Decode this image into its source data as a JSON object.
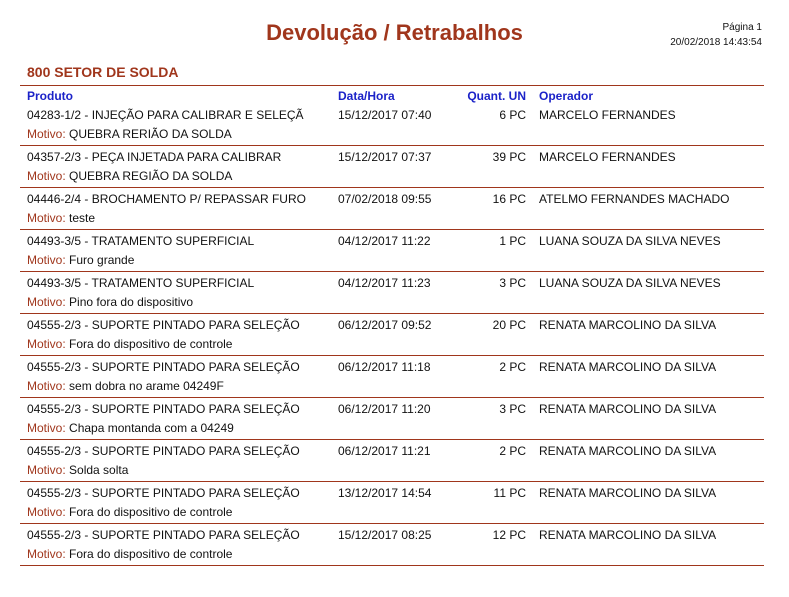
{
  "report": {
    "title": "Devolução / Retrabalhos",
    "page": "Página 1",
    "datetime": "20/02/2018 14:43:54"
  },
  "section": {
    "title": "800 SETOR DE SOLDA"
  },
  "columns": {
    "produto": "Produto",
    "data_hora": "Data/Hora",
    "quant_un": "Quant. UN",
    "operador": "Operador"
  },
  "motivo_label": "Motivo:",
  "rows": [
    {
      "produto": "04283-1/2 - INJEÇÃO PARA CALIBRAR E SELEÇÃ",
      "data_hora": "15/12/2017 07:40",
      "quant": "6 PC",
      "operador": "MARCELO FERNANDES",
      "motivo": "QUEBRA RERIÃO DA SOLDA"
    },
    {
      "produto": "04357-2/3 - PEÇA INJETADA PARA CALIBRAR",
      "data_hora": "15/12/2017 07:37",
      "quant": "39 PC",
      "operador": "MARCELO FERNANDES",
      "motivo": "QUEBRA REGIÃO DA SOLDA"
    },
    {
      "produto": "04446-2/4 - BROCHAMENTO P/ REPASSAR FURO",
      "data_hora": "07/02/2018 09:55",
      "quant": "16 PC",
      "operador": "ATELMO FERNANDES MACHADO",
      "motivo": "teste"
    },
    {
      "produto": "04493-3/5 - TRATAMENTO SUPERFICIAL",
      "data_hora": "04/12/2017 11:22",
      "quant": "1 PC",
      "operador": "LUANA SOUZA DA  SILVA NEVES",
      "motivo": "Furo grande"
    },
    {
      "produto": "04493-3/5 - TRATAMENTO SUPERFICIAL",
      "data_hora": "04/12/2017 11:23",
      "quant": "3 PC",
      "operador": "LUANA SOUZA DA  SILVA NEVES",
      "motivo": "Pino fora do dispositivo"
    },
    {
      "produto": "04555-2/3 - SUPORTE PINTADO PARA SELEÇÃO",
      "data_hora": "06/12/2017 09:52",
      "quant": "20 PC",
      "operador": "RENATA MARCOLINO DA SILVA",
      "motivo": "Fora do dispositivo de controle"
    },
    {
      "produto": "04555-2/3 - SUPORTE PINTADO PARA SELEÇÃO",
      "data_hora": "06/12/2017 11:18",
      "quant": "2 PC",
      "operador": "RENATA MARCOLINO DA SILVA",
      "motivo": "sem dobra no arame 04249F"
    },
    {
      "produto": "04555-2/3 - SUPORTE PINTADO PARA SELEÇÃO",
      "data_hora": "06/12/2017 11:20",
      "quant": "3 PC",
      "operador": "RENATA MARCOLINO DA SILVA",
      "motivo": "Chapa montanda com a 04249"
    },
    {
      "produto": "04555-2/3 - SUPORTE PINTADO PARA SELEÇÃO",
      "data_hora": "06/12/2017 11:21",
      "quant": "2 PC",
      "operador": "RENATA MARCOLINO DA SILVA",
      "motivo": "Solda solta"
    },
    {
      "produto": "04555-2/3 - SUPORTE PINTADO PARA SELEÇÃO",
      "data_hora": "13/12/2017 14:54",
      "quant": "11 PC",
      "operador": "RENATA MARCOLINO DA SILVA",
      "motivo": "Fora do dispositivo de controle"
    },
    {
      "produto": "04555-2/3 - SUPORTE PINTADO PARA SELEÇÃO",
      "data_hora": "15/12/2017 08:25",
      "quant": "12 PC",
      "operador": "RENATA MARCOLINO DA SILVA",
      "motivo": "Fora do dispositivo de controle"
    }
  ],
  "colors": {
    "title": "#a0361c",
    "header": "#1b22c8",
    "rule": "#a0361c"
  }
}
